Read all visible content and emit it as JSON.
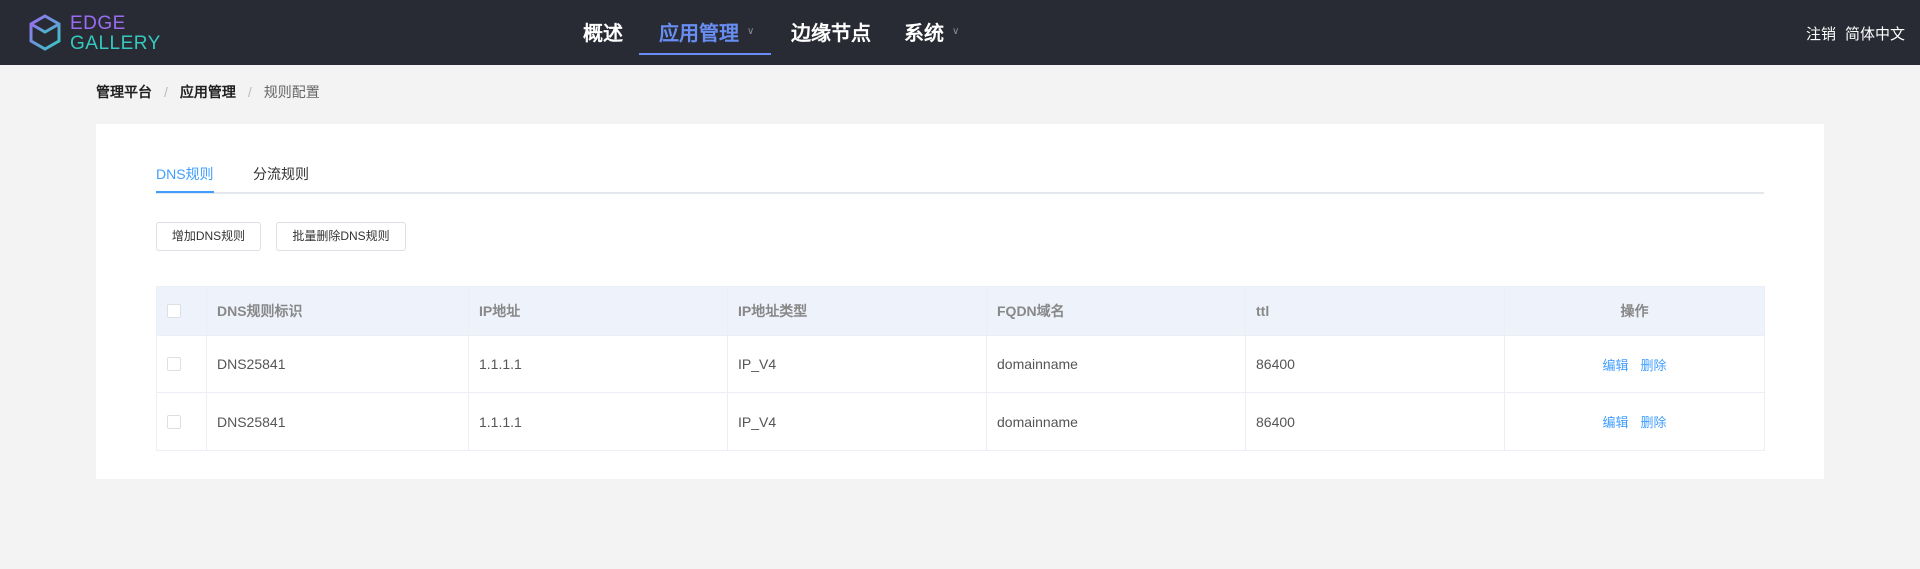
{
  "brand": {
    "line1": "EDGE",
    "line2": "GALLERY",
    "colors": {
      "line1": "#9b6cf2",
      "line2": "#35c9c1"
    }
  },
  "nav": {
    "items": [
      {
        "label": "概述",
        "has_caret": false
      },
      {
        "label": "应用管理",
        "has_caret": true,
        "active": true
      },
      {
        "label": "边缘节点",
        "has_caret": false
      },
      {
        "label": "系统",
        "has_caret": true
      }
    ],
    "caret_icon": "chevron-down-icon",
    "logout": "注销",
    "language": "简体中文"
  },
  "breadcrumb": {
    "items": [
      "管理平台",
      "应用管理",
      "规则配置"
    ],
    "separator": "/"
  },
  "tabs": [
    {
      "label": "DNS规则",
      "active": true
    },
    {
      "label": "分流规则",
      "active": false
    }
  ],
  "toolbar": {
    "add_label": "增加DNS规则",
    "batch_delete_label": "批量删除DNS规则"
  },
  "table": {
    "columns": [
      "DNS规则标识",
      "IP地址",
      "IP地址类型",
      "FQDN域名",
      "ttl",
      "操作"
    ],
    "rows": [
      {
        "id": "DNS25841",
        "ip": "1.1.1.1",
        "ip_type": "IP_V4",
        "fqdn": "domainname",
        "ttl": "86400"
      },
      {
        "id": "DNS25841",
        "ip": "1.1.1.1",
        "ip_type": "IP_V4",
        "fqdn": "domainname",
        "ttl": "86400"
      }
    ],
    "actions": {
      "edit": "编辑",
      "delete": "删除"
    }
  },
  "colors": {
    "navbar_bg": "#282b33",
    "accent": "#688ef3",
    "link": "#409eff",
    "page_bg": "#f3f3f4"
  }
}
